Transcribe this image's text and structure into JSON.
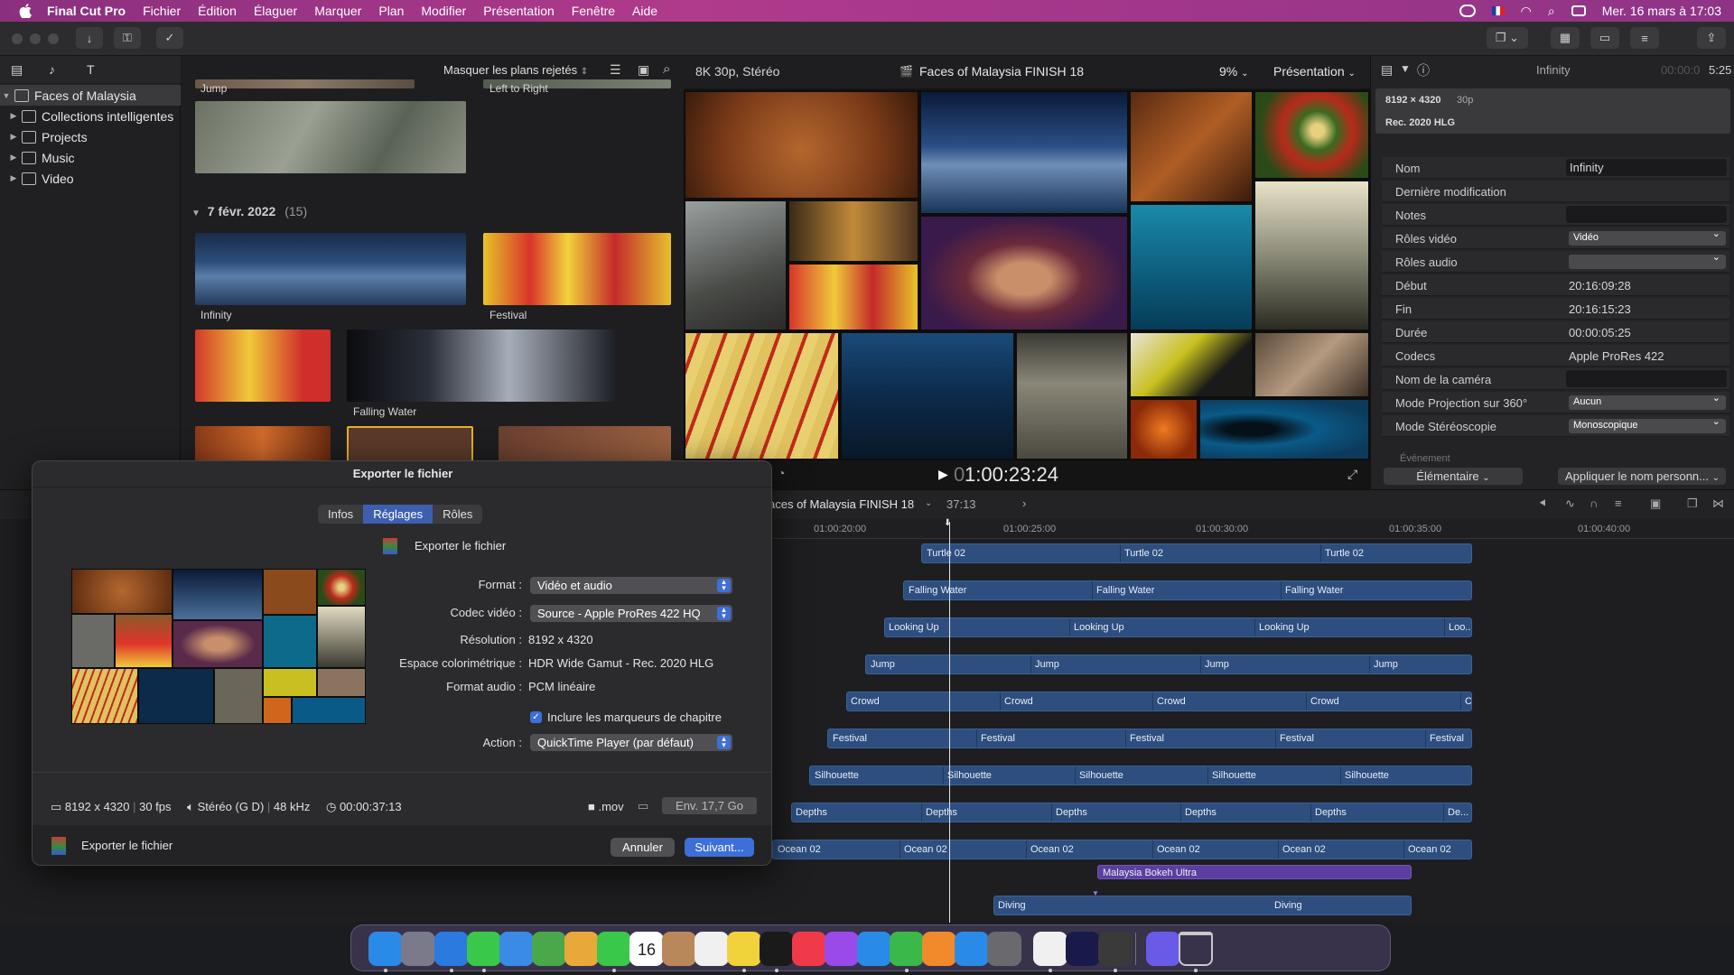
{
  "menubar": {
    "app_name": "Final Cut Pro",
    "items": [
      "Fichier",
      "Édition",
      "Élaguer",
      "Marquer",
      "Plan",
      "Modifier",
      "Présentation",
      "Fenêtre",
      "Aide"
    ],
    "datetime": "Mer. 16 mars à  17:03"
  },
  "browser": {
    "filter_label": "Masquer les plans rejetés",
    "library": "Faces of Malaysia",
    "sidebar_items": [
      "Collections intelligentes",
      "Projects",
      "Music",
      "Video"
    ],
    "group_date": "7 févr. 2022",
    "group_count": "(15)",
    "clip_labels": {
      "jump": "Jump",
      "left_to_right": "Left to Right",
      "infinity": "Infinity",
      "festival": "Festival",
      "falling_water": "Falling Water"
    }
  },
  "viewer": {
    "format": "8K 30p, Stéréo",
    "project": "Faces of Malaysia FINISH 18",
    "zoom": "9%",
    "view_menu": "Présentation",
    "timecode_dim": "0",
    "timecode": "1:00:23:24"
  },
  "inspector": {
    "clip_name": "Infinity",
    "duration_dim": "00:00:0",
    "duration": "5:25",
    "resolution": "8192 × 4320",
    "framerate": "30p",
    "colorspace": "Rec. 2020 HLG",
    "rows": [
      {
        "key": "Nom",
        "value": "Infinity",
        "kind": "field"
      },
      {
        "key": "Dernière modification",
        "value": "",
        "kind": "text"
      },
      {
        "key": "Notes",
        "value": "",
        "kind": "field"
      },
      {
        "key": "Rôles vidéo",
        "value": "Vidéo",
        "kind": "popup"
      },
      {
        "key": "Rôles audio",
        "value": "",
        "kind": "popup"
      },
      {
        "key": "Début",
        "value": "20:16:09:28",
        "kind": "text"
      },
      {
        "key": "Fin",
        "value": "20:16:15:23",
        "kind": "text"
      },
      {
        "key": "Durée",
        "value": "00:00:05:25",
        "kind": "text"
      },
      {
        "key": "Codecs",
        "value": "Apple ProRes 422",
        "kind": "text"
      },
      {
        "key": "Nom de la caméra",
        "value": "",
        "kind": "field"
      },
      {
        "key": "Mode Projection sur 360°",
        "value": "Aucun",
        "kind": "popup"
      },
      {
        "key": "Mode Stéréoscopie",
        "value": "Monoscopique",
        "kind": "popup"
      }
    ],
    "next_section": "Événement",
    "metadata_view": "Élémentaire",
    "apply_name": "Appliquer le nom personn..."
  },
  "timeline": {
    "project": "aces of Malaysia FINISH 18",
    "duration": "37:13",
    "ruler": [
      "01:00:20:00",
      "01:00:25:00",
      "01:00:30:00",
      "01:00:35:00",
      "01:00:40:00"
    ],
    "tracks": [
      {
        "name": "Turtle 02",
        "clips": [
          "Turtle 02",
          "Turtle 02",
          "Turtle 02"
        ]
      },
      {
        "name": "Falling Water",
        "clips": [
          "Falling Water",
          "Falling Water",
          "Falling Water"
        ]
      },
      {
        "name": "Looking Up",
        "clips": [
          "Looking Up",
          "Looking Up",
          "Looking Up",
          "Loo..."
        ]
      },
      {
        "name": "Jump",
        "clips": [
          "Jump",
          "Jump",
          "Jump",
          "Jump"
        ]
      },
      {
        "name": "Crowd",
        "clips": [
          "Crowd",
          "Crowd",
          "Crowd",
          "Crowd",
          "C"
        ]
      },
      {
        "name": "Festival",
        "clips": [
          "Festival",
          "Festival",
          "Festival",
          "Festival",
          "Festival"
        ]
      },
      {
        "name": "Silhouette",
        "clips": [
          "Silhouette",
          "Silhouette",
          "Silhouette",
          "Silhouette",
          "Silhouette"
        ]
      },
      {
        "name": "Depths",
        "clips": [
          "Depths",
          "Depths",
          "Depths",
          "Depths",
          "Depths",
          "De..."
        ]
      },
      {
        "name": "Ocean 02",
        "clips": [
          "Ocean 02",
          "Ocean 02",
          "Ocean 02",
          "Ocean 02",
          "Ocean 02",
          "Ocean 02"
        ]
      }
    ],
    "music_clip": "Malaysia Bokeh Ultra",
    "bottom_clips": [
      "Diving",
      "Diving"
    ]
  },
  "dialog": {
    "title": "Exporter le fichier",
    "tabs": [
      "Infos",
      "Réglages",
      "Rôles"
    ],
    "active_tab": "Réglages",
    "destination": "Exporter le fichier",
    "format_label": "Format :",
    "format_value": "Vidéo et audio",
    "codec_label": "Codec vidéo :",
    "codec_value": "Source - Apple ProRes 422 HQ",
    "resolution_label": "Résolution :",
    "resolution_value": "8192 x 4320",
    "colorspace_label": "Espace colorimétrique :",
    "colorspace_value": "HDR Wide Gamut - Rec. 2020 HLG",
    "audio_label": "Format audio :",
    "audio_value": "PCM linéaire",
    "chapter_markers": "Inclure les marqueurs de chapitre",
    "action_label": "Action :",
    "action_value": "QuickTime Player (par défaut)",
    "summary_res": "8192 x 4320",
    "summary_fps": "30 fps",
    "summary_audio": "Stéréo (G D)",
    "summary_rate": "48 kHz",
    "summary_duration": "00:00:37:13",
    "file_ext": ".mov",
    "file_size": "Env. 17,7 Go",
    "footer_label": "Exporter le fichier",
    "cancel": "Annuler",
    "next": "Suivant..."
  },
  "colors": {
    "accent": "#3e5fb0",
    "clip_blue": "#2d4e7e",
    "music_purple": "#5b3fa0",
    "menubar": "#a0368a"
  },
  "dock_apps": [
    "finder-icon",
    "launchpad-icon",
    "safari-icon",
    "messages-icon",
    "mail-icon",
    "maps-icon",
    "photos-icon",
    "facetime-icon",
    "calendar-icon",
    "contacts-icon",
    "reminders-icon",
    "notes-icon",
    "tv-icon",
    "music-icon",
    "podcasts-icon",
    "keynote-icon",
    "numbers-icon",
    "pages-icon",
    "app-store-icon",
    "settings-icon",
    "slack-icon",
    "premiere-icon",
    "final-cut-icon",
    "motion-icon",
    "trash-icon"
  ],
  "dock_calendar_day": "16"
}
